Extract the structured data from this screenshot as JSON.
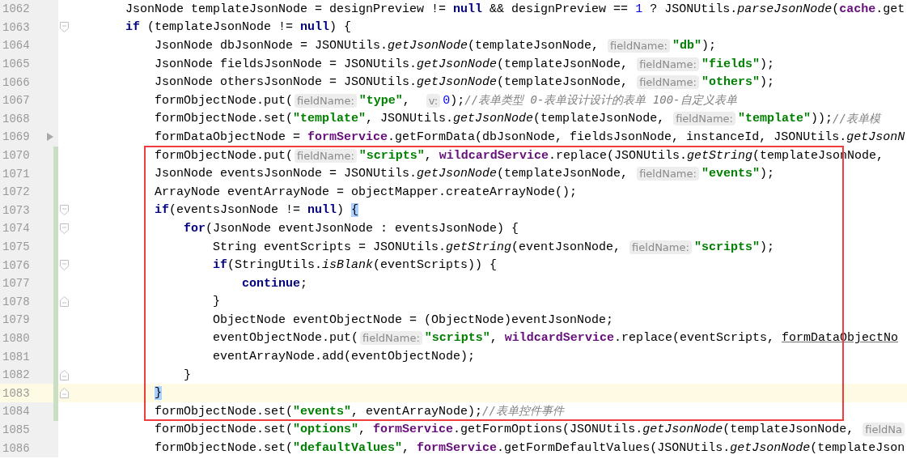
{
  "lines": [
    {
      "number": "1062",
      "current": false,
      "changed": false,
      "tokens": [
        {
          "kind": "plain",
          "text": "JsonNode templateJsonNode = designPreview != "
        },
        {
          "kind": "keyword",
          "text": "null"
        },
        {
          "kind": "plain",
          "text": " && designPreview == "
        },
        {
          "kind": "number",
          "text": "1"
        },
        {
          "kind": "plain",
          "text": " ? JSONUtils."
        },
        {
          "kind": "static",
          "text": "parseJsonNode"
        },
        {
          "kind": "plain",
          "text": "("
        },
        {
          "kind": "field",
          "text": "cache"
        },
        {
          "kind": "plain",
          "text": ".get"
        }
      ]
    },
    {
      "number": "1063",
      "current": false,
      "changed": false,
      "fold": {
        "kind": "start"
      },
      "tokens": [
        {
          "kind": "keyword",
          "text": "if"
        },
        {
          "kind": "plain",
          "text": " (templateJsonNode != "
        },
        {
          "kind": "keyword",
          "text": "null"
        },
        {
          "kind": "plain",
          "text": ") {"
        }
      ],
      "children": [
        {
          "number": "1064",
          "current": false,
          "changed": false,
          "tokens": [
            {
              "kind": "plain",
              "text": "JsonNode dbJsonNode = JSONUtils."
            },
            {
              "kind": "static",
              "text": "getJsonNode"
            },
            {
              "kind": "plain",
              "text": "(templateJsonNode, "
            },
            {
              "kind": "hint",
              "text": "fieldName:"
            },
            {
              "kind": "string",
              "text": "\"db\""
            },
            {
              "kind": "plain",
              "text": ");"
            }
          ]
        },
        {
          "number": "1065",
          "current": false,
          "changed": false,
          "tokens": [
            {
              "kind": "plain",
              "text": "JsonNode fieldsJsonNode = JSONUtils."
            },
            {
              "kind": "static",
              "text": "getJsonNode"
            },
            {
              "kind": "plain",
              "text": "(templateJsonNode, "
            },
            {
              "kind": "hint",
              "text": "fieldName:"
            },
            {
              "kind": "string",
              "text": "\"fields\""
            },
            {
              "kind": "plain",
              "text": ");"
            }
          ]
        },
        {
          "number": "1066",
          "current": false,
          "changed": false,
          "tokens": [
            {
              "kind": "plain",
              "text": "JsonNode othersJsonNode = JSONUtils."
            },
            {
              "kind": "static",
              "text": "getJsonNode"
            },
            {
              "kind": "plain",
              "text": "(templateJsonNode, "
            },
            {
              "kind": "hint",
              "text": "fieldName:"
            },
            {
              "kind": "string",
              "text": "\"others\""
            },
            {
              "kind": "plain",
              "text": ");"
            }
          ]
        },
        {
          "number": "1067",
          "current": false,
          "changed": false,
          "tokens": [
            {
              "kind": "plain",
              "text": "formObjectNode.put("
            },
            {
              "kind": "hint",
              "text": "fieldName:"
            },
            {
              "kind": "string",
              "text": "\"type\""
            },
            {
              "kind": "plain",
              "text": ",  "
            },
            {
              "kind": "hint",
              "text": "v:"
            },
            {
              "kind": "number",
              "text": "0"
            },
            {
              "kind": "plain",
              "text": ");"
            },
            {
              "kind": "comment",
              "text": "//表单类型 0-表单设计设计的表单 100-自定义表单"
            }
          ]
        },
        {
          "number": "1068",
          "current": false,
          "changed": false,
          "tokens": [
            {
              "kind": "plain",
              "text": "formObjectNode.set("
            },
            {
              "kind": "string",
              "text": "\"template\""
            },
            {
              "kind": "plain",
              "text": ", JSONUtils."
            },
            {
              "kind": "static",
              "text": "getJsonNode"
            },
            {
              "kind": "plain",
              "text": "(templateJsonNode, "
            },
            {
              "kind": "hint",
              "text": "fieldName:"
            },
            {
              "kind": "string",
              "text": "\"template\""
            },
            {
              "kind": "plain",
              "text": "));"
            },
            {
              "kind": "comment",
              "text": "//表单模"
            }
          ]
        },
        {
          "number": "1069",
          "current": false,
          "changed": false,
          "arrow": true,
          "tokens": [
            {
              "kind": "plain",
              "text": "formDataObjectNode = "
            },
            {
              "kind": "field",
              "text": "formService"
            },
            {
              "kind": "plain",
              "text": ".getFormData(dbJsonNode, fieldsJsonNode, instanceId, JSONUtils."
            },
            {
              "kind": "static",
              "text": "getJsonN"
            }
          ]
        },
        {
          "number": "1070",
          "current": false,
          "changed": true,
          "tokens": [
            {
              "kind": "plain",
              "text": "formObjectNode.put("
            },
            {
              "kind": "hint",
              "text": "fieldName:"
            },
            {
              "kind": "string",
              "text": "\"scripts\""
            },
            {
              "kind": "plain",
              "text": ", "
            },
            {
              "kind": "field",
              "text": "wildcardService"
            },
            {
              "kind": "plain",
              "text": ".replace(JSONUtils."
            },
            {
              "kind": "static",
              "text": "getString"
            },
            {
              "kind": "plain",
              "text": "(templateJsonNode,"
            }
          ]
        },
        {
          "number": "1071",
          "current": false,
          "changed": true,
          "tokens": [
            {
              "kind": "plain",
              "text": "JsonNode eventsJsonNode = JSONUtils."
            },
            {
              "kind": "static",
              "text": "getJsonNode"
            },
            {
              "kind": "plain",
              "text": "(templateJsonNode, "
            },
            {
              "kind": "hint",
              "text": "fieldName:"
            },
            {
              "kind": "string",
              "text": "\"events\""
            },
            {
              "kind": "plain",
              "text": ");"
            }
          ]
        },
        {
          "number": "1072",
          "current": false,
          "changed": true,
          "tokens": [
            {
              "kind": "plain",
              "text": "ArrayNode eventArrayNode = objectMapper.createArrayNode();"
            }
          ]
        },
        {
          "number": "1073",
          "current": false,
          "changed": true,
          "fold": {
            "kind": "start"
          },
          "tokens": [
            {
              "kind": "keyword",
              "text": "if"
            },
            {
              "kind": "plain",
              "text": "(eventsJsonNode != "
            },
            {
              "kind": "keyword",
              "text": "null"
            },
            {
              "kind": "plain",
              "text": ") "
            },
            {
              "kind": "brace",
              "text": "{"
            }
          ],
          "children": [
            {
              "number": "1074",
              "current": false,
              "changed": true,
              "fold": {
                "kind": "start"
              },
              "tokens": [
                {
                  "kind": "keyword",
                  "text": "for"
                },
                {
                  "kind": "plain",
                  "text": "(JsonNode eventJsonNode : eventsJsonNode) {"
                }
              ],
              "children": [
                {
                  "number": "1075",
                  "current": false,
                  "changed": true,
                  "tokens": [
                    {
                      "kind": "plain",
                      "text": "String eventScripts = JSONUtils."
                    },
                    {
                      "kind": "static",
                      "text": "getString"
                    },
                    {
                      "kind": "plain",
                      "text": "(eventJsonNode, "
                    },
                    {
                      "kind": "hint",
                      "text": "fieldName:"
                    },
                    {
                      "kind": "string",
                      "text": "\"scripts\""
                    },
                    {
                      "kind": "plain",
                      "text": ");"
                    }
                  ]
                },
                {
                  "number": "1076",
                  "current": false,
                  "changed": true,
                  "fold": {
                    "kind": "start"
                  },
                  "tokens": [
                    {
                      "kind": "keyword",
                      "text": "if"
                    },
                    {
                      "kind": "plain",
                      "text": "(StringUtils."
                    },
                    {
                      "kind": "static",
                      "text": "isBlank"
                    },
                    {
                      "kind": "plain",
                      "text": "(eventScripts)) {"
                    }
                  ],
                  "children": [
                    {
                      "number": "1077",
                      "current": false,
                      "changed": true,
                      "tokens": [
                        {
                          "kind": "keyword",
                          "text": "continue"
                        },
                        {
                          "kind": "plain",
                          "text": ";"
                        }
                      ]
                    }
                  ]
                },
                {
                  "number": "1078",
                  "current": false,
                  "changed": true,
                  "fold": {
                    "kind": "end"
                  },
                  "tokens": [
                    {
                      "kind": "plain",
                      "text": "}"
                    }
                  ]
                },
                {
                  "number": "1079",
                  "current": false,
                  "changed": true,
                  "tokens": [
                    {
                      "kind": "plain",
                      "text": "ObjectNode eventObjectNode = (ObjectNode)eventJsonNode;"
                    }
                  ]
                },
                {
                  "number": "1080",
                  "current": false,
                  "changed": true,
                  "tokens": [
                    {
                      "kind": "plain",
                      "text": "eventObjectNode.put("
                    },
                    {
                      "kind": "hint",
                      "text": "fieldName:"
                    },
                    {
                      "kind": "string",
                      "text": "\"scripts\""
                    },
                    {
                      "kind": "plain",
                      "text": ", "
                    },
                    {
                      "kind": "field",
                      "text": "wildcardService"
                    },
                    {
                      "kind": "plain",
                      "text": ".replace(eventScripts, "
                    },
                    {
                      "kind": "underline",
                      "text": "formDataObjectNo"
                    }
                  ]
                },
                {
                  "number": "1081",
                  "current": false,
                  "changed": true,
                  "tokens": [
                    {
                      "kind": "plain",
                      "text": "eventArrayNode.add(eventObjectNode);"
                    }
                  ]
                }
              ]
            },
            {
              "number": "1082",
              "current": false,
              "changed": true,
              "fold": {
                "kind": "end"
              },
              "tokens": [
                {
                  "kind": "plain",
                  "text": "}"
                }
              ]
            }
          ]
        },
        {
          "number": "1083",
          "current": true,
          "changed": true,
          "fold": {
            "kind": "end"
          },
          "tokens": [
            {
              "kind": "brace",
              "text": "}"
            }
          ]
        },
        {
          "number": "1084",
          "current": false,
          "changed": true,
          "tokens": [
            {
              "kind": "plain",
              "text": "formObjectNode.set("
            },
            {
              "kind": "string",
              "text": "\"events\""
            },
            {
              "kind": "plain",
              "text": ", eventArrayNode);"
            },
            {
              "kind": "comment",
              "text": "//表单控件事件"
            }
          ]
        },
        {
          "number": "1085",
          "current": false,
          "changed": false,
          "tokens": [
            {
              "kind": "plain",
              "text": "formObjectNode.set("
            },
            {
              "kind": "string",
              "text": "\"options\""
            },
            {
              "kind": "plain",
              "text": ", "
            },
            {
              "kind": "field",
              "text": "formService"
            },
            {
              "kind": "plain",
              "text": ".getFormOptions(JSONUtils."
            },
            {
              "kind": "static",
              "text": "getJsonNode"
            },
            {
              "kind": "plain",
              "text": "(templateJsonNode, "
            },
            {
              "kind": "hint",
              "text": "fieldNa"
            }
          ]
        },
        {
          "number": "1086",
          "current": false,
          "changed": false,
          "tokens": [
            {
              "kind": "plain",
              "text": "formObjectNode.set("
            },
            {
              "kind": "string",
              "text": "\"defaultValues\""
            },
            {
              "kind": "plain",
              "text": ", "
            },
            {
              "kind": "field",
              "text": "formService"
            },
            {
              "kind": "plain",
              "text": ".getFormDefaultValues(JSONUtils."
            },
            {
              "kind": "static",
              "text": "getJsonNode"
            },
            {
              "kind": "plain",
              "text": "(templateJson"
            }
          ]
        }
      ]
    }
  ]
}
